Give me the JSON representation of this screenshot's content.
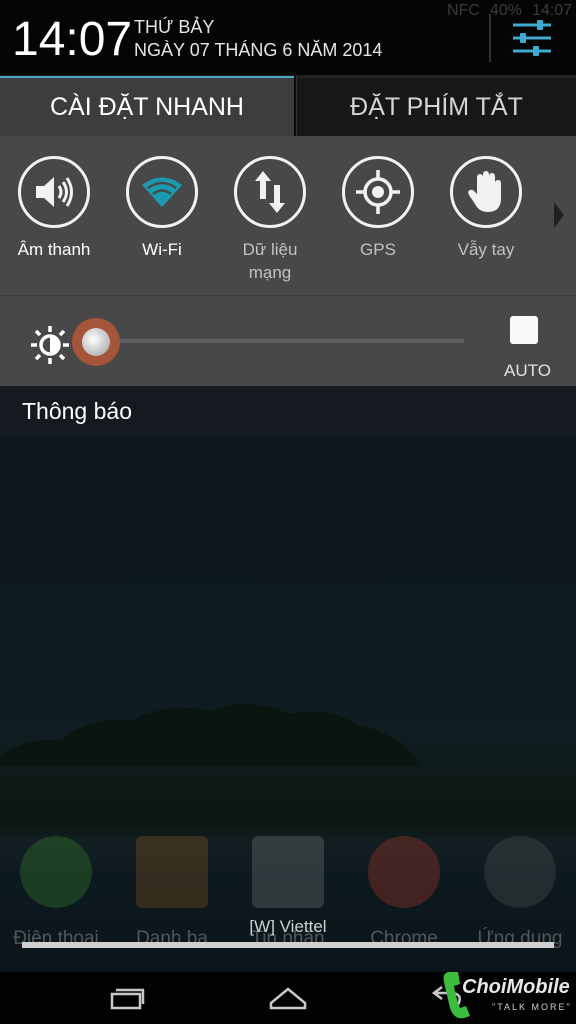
{
  "status_bar": {
    "nfc": "NFC",
    "battery": "40%",
    "time": "14:07"
  },
  "header": {
    "clock": "14:07",
    "day": "THỨ BẢY",
    "date": "NGÀY 07 THÁNG 6 NĂM 2014",
    "settings_icon": "sliders-icon"
  },
  "tabs": [
    {
      "label": "CÀI ĐẶT NHANH",
      "active": true
    },
    {
      "label": "ĐẶT PHÍM TẮT",
      "active": false
    }
  ],
  "quick_settings": [
    {
      "label": "Âm thanh",
      "icon": "speaker-icon",
      "on": true
    },
    {
      "label": "Wi-Fi",
      "icon": "wifi-icon",
      "on": true
    },
    {
      "label": "Dữ liệu\nmạng",
      "icon": "data-arrows-icon",
      "on": false
    },
    {
      "label": "GPS",
      "icon": "gps-icon",
      "on": false
    },
    {
      "label": "Vẫy tay",
      "icon": "hand-icon",
      "on": false
    }
  ],
  "brightness": {
    "level": 0.0,
    "auto_label": "AUTO",
    "auto_checked": false
  },
  "notifications": {
    "heading": "Thông báo"
  },
  "home_dock": [
    {
      "label": "Điện thoại",
      "icon": "phone-icon"
    },
    {
      "label": "Danh bạ",
      "icon": "contacts-icon"
    },
    {
      "label": "Tin nhắn",
      "icon": "messages-icon"
    },
    {
      "label": "Chrome",
      "icon": "chrome-icon"
    },
    {
      "label": "Ứng dụng",
      "icon": "apps-icon"
    }
  ],
  "carrier": "[W] Viettel",
  "nav": {
    "recent": "recent-apps-icon",
    "home": "home-icon",
    "back": "back-icon"
  },
  "watermark": {
    "brand": "ChoiMobile",
    "tagline": "\"TALK MORE\""
  },
  "colors": {
    "accent": "#4aa6c8",
    "wifi_on": "#1a9bb0",
    "slider_thumb": "#a4553a",
    "panel": "#484848"
  }
}
